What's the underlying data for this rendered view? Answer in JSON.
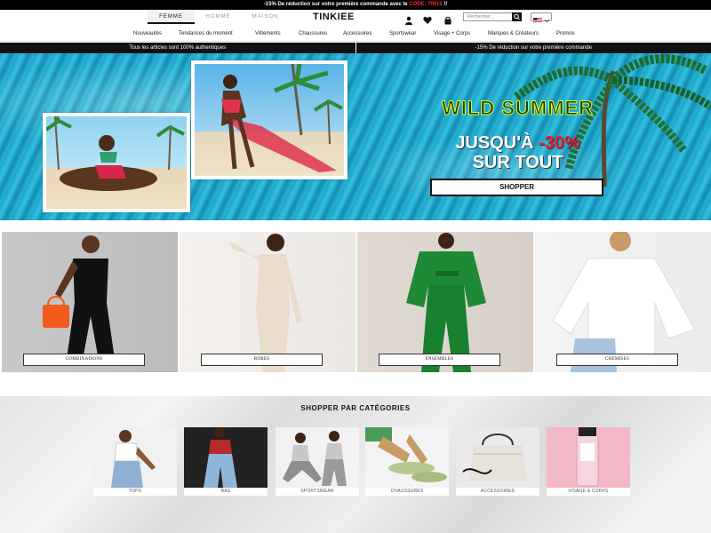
{
  "promo": {
    "text": "-15% De réduction sur votre première commande avec le",
    "code_label": "CODE: TIN15",
    "suffix": "!!"
  },
  "header": {
    "tabs": [
      "FEMME",
      "HOMME",
      "MAISON"
    ],
    "active_tab": "FEMME",
    "logo": "TINKIEE",
    "search_placeholder": "Rechercher..."
  },
  "nav": {
    "items": [
      "Nouveautés",
      "Tendances du moment",
      "Vêtements",
      "Chaussures",
      "Accessoires",
      "Sportswear",
      "Visage + Corps",
      "Marques & Créateurs",
      "Promos"
    ]
  },
  "strips": {
    "left": "Tous les articles sont 100% authentiques",
    "right": "-15% De réduction sur votre première commande"
  },
  "hero": {
    "title": "WILD SUMMER",
    "line1_prefix": "JUSQU'À ",
    "line1_highlight": "-30%",
    "line2": "SUR TOUT",
    "cta": "SHOPPER"
  },
  "categories": [
    {
      "label": "COMBINAISONS"
    },
    {
      "label": "ROBES"
    },
    {
      "label": "ENSEMBLES"
    },
    {
      "label": "CHEMISES"
    }
  ],
  "shop_by": {
    "title": "SHOPPER PAR CATÉGORIES",
    "tiles": [
      {
        "label": "TOPS"
      },
      {
        "label": "BAS"
      },
      {
        "label": "SPORTSWEAR"
      },
      {
        "label": "CHAUSSURES"
      },
      {
        "label": "ACCESSOIRES"
      },
      {
        "label": "VISAGE & CORPS"
      }
    ]
  },
  "colors": {
    "accent_red": "#ff2a2a",
    "hero_lime": "#d7ff2a",
    "pool_blue": "#1aa3c7"
  }
}
